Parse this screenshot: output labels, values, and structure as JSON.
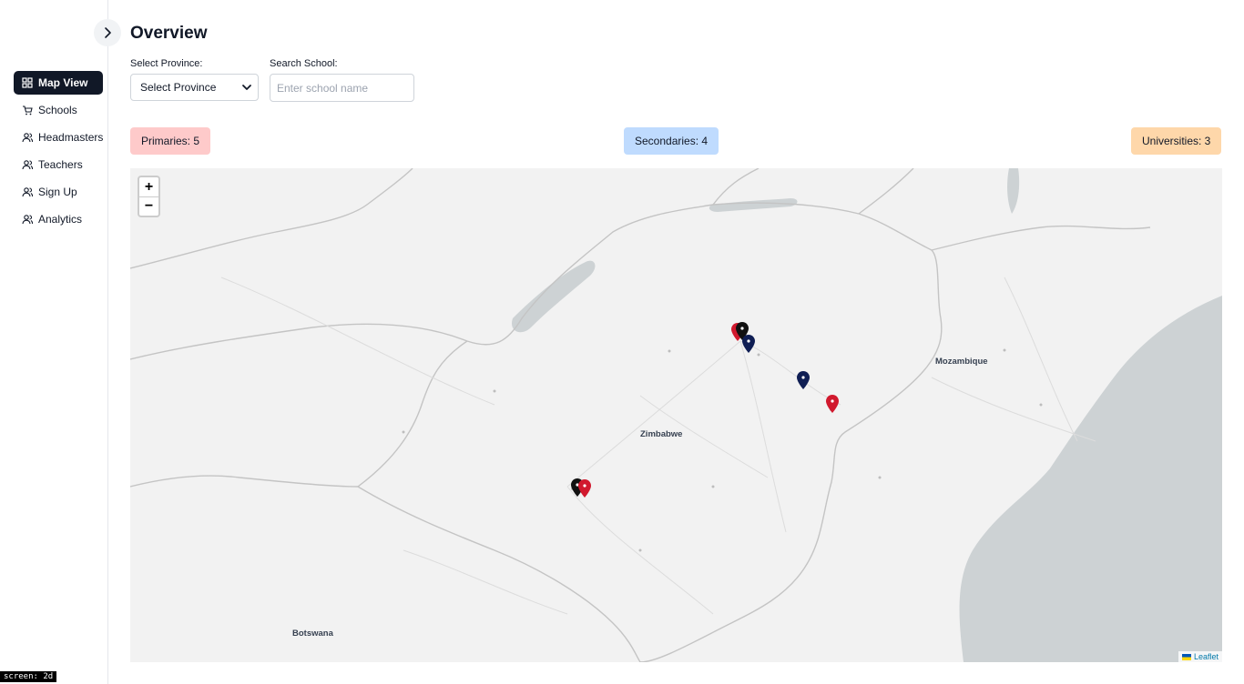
{
  "sidebar": {
    "items": [
      {
        "label": "Map View",
        "icon": "map-view-icon",
        "active": true
      },
      {
        "label": "Schools",
        "icon": "cart-icon",
        "active": false
      },
      {
        "label": "Headmasters",
        "icon": "users-icon",
        "active": false
      },
      {
        "label": "Teachers",
        "icon": "users-icon",
        "active": false
      },
      {
        "label": "Sign Up",
        "icon": "users-icon",
        "active": false
      },
      {
        "label": "Analytics",
        "icon": "users-icon",
        "active": false
      }
    ]
  },
  "header": {
    "title": "Overview"
  },
  "filters": {
    "province_label": "Select Province:",
    "province_value": "Select Province",
    "search_label": "Search School:",
    "search_placeholder": "Enter school name",
    "search_value": ""
  },
  "stats": {
    "primaries": "Primaries: 5",
    "secondaries": "Secondaries: 4",
    "universities": "Universities: 3"
  },
  "map": {
    "zoom_in": "+",
    "zoom_out": "−",
    "attribution": "Leaflet",
    "labels": {
      "zimbabwe": "Zimbabwe",
      "mozambique": "Mozambique",
      "botswana": "Botswana"
    },
    "marker_colors": {
      "red": "#d1192e",
      "navy": "#0f1e54",
      "black": "#111111"
    }
  },
  "screen_tag": "screen: 2d"
}
